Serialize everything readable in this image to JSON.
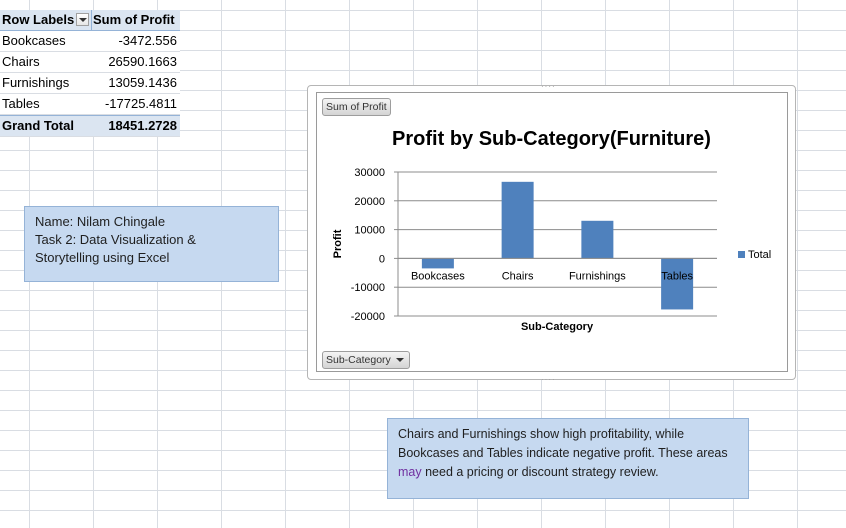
{
  "pivot": {
    "header_row_label": "Row Labels",
    "header_value": "Sum of Profit",
    "rows": [
      {
        "label": "Bookcases",
        "value": "-3472.556"
      },
      {
        "label": "Chairs",
        "value": "26590.1663"
      },
      {
        "label": "Furnishings",
        "value": "13059.1436"
      },
      {
        "label": "Tables",
        "value": "-17725.4811"
      }
    ],
    "total_label": "Grand Total",
    "total_value": "18451.2728"
  },
  "notes": {
    "info_lines": [
      "Name: Nilam Chingale",
      "Task 2: Data Visualization &",
      "Storytelling using Excel"
    ],
    "insight_part1": "Chairs and Furnishings show high profitability, while Bookcases and Tables indicate negative profit. These areas ",
    "insight_highlight": "may",
    "insight_part2": " need a pricing or discount strategy review."
  },
  "chart_buttons": {
    "value_field": "Sum of Profit",
    "axis_field": "Sub-Category"
  },
  "chart_data": {
    "type": "bar",
    "title": "Profit by Sub-Category(Furniture)",
    "xlabel": "Sub-Category",
    "ylabel": "Profit",
    "categories": [
      "Bookcases",
      "Chairs",
      "Furnishings",
      "Tables"
    ],
    "series": [
      {
        "name": "Total",
        "values": [
          -3472.556,
          26590.1663,
          13059.1436,
          -17725.4811
        ],
        "color": "#4f81bd"
      }
    ],
    "ylim": [
      -20000,
      30000
    ],
    "yticks": [
      "30000",
      "20000",
      "10000",
      "0",
      "-10000",
      "-20000"
    ],
    "grid": true,
    "legend": "right"
  }
}
